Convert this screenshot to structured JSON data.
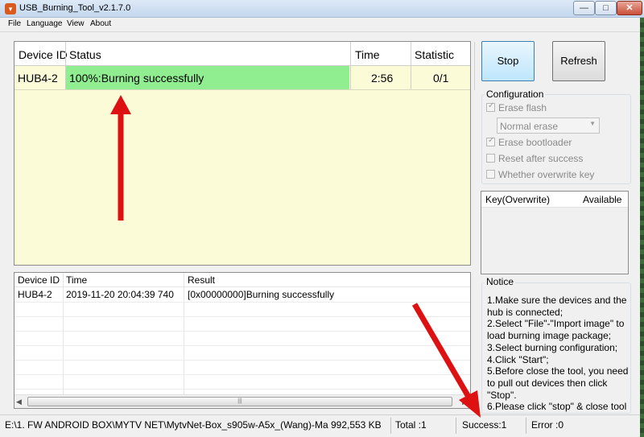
{
  "window": {
    "title": "USB_Burning_Tool_v2.1.7.0",
    "minimize": "—",
    "maximize": "□",
    "close": "✕"
  },
  "menu": {
    "items": [
      "File",
      "Language",
      "View",
      "About"
    ]
  },
  "device_table": {
    "headers": [
      "Device ID",
      "Status",
      "Time",
      "Statistic"
    ],
    "rows": [
      {
        "device_id": "HUB4-2",
        "status": "100%:Burning successfully",
        "time": "2:56",
        "statistic": "0/1"
      }
    ],
    "status_color": "#90ee90",
    "background": "#fbfbd8"
  },
  "buttons": {
    "stop": "Stop",
    "refresh": "Refresh"
  },
  "configuration": {
    "title": "Configuration",
    "erase_flash": {
      "label": "Erase flash",
      "checked": true,
      "enabled": false
    },
    "erase_mode": "Normal erase",
    "erase_bootloader": {
      "label": "Erase bootloader",
      "checked": true,
      "enabled": false
    },
    "reset_after_success": {
      "label": "Reset after success",
      "checked": false,
      "enabled": false
    },
    "overwrite_key": {
      "label": "Whether overwrite key",
      "checked": false,
      "enabled": false
    }
  },
  "key_table": {
    "headers": [
      "Key(Overwrite)",
      "Available"
    ]
  },
  "log_table": {
    "headers": [
      "Device ID",
      "Time",
      "Result"
    ],
    "rows": [
      {
        "device_id": "HUB4-2",
        "time": "2019-11-20 20:04:39 740",
        "result": "[0x00000000]Burning successfully"
      }
    ]
  },
  "notice": {
    "title": "Notice",
    "lines": [
      "1.Make sure the devices and the hub is connected;",
      "2.Select \"File\"-\"Import image\" to load burning image package;",
      "3.Select burning configuration;",
      "4.Click \"Start\";",
      "5.Before close the tool, you need to pull out devices then click \"Stop\".",
      "6.Please click \"stop\" & close tool"
    ]
  },
  "statusbar": {
    "image_path": "E:\\1. FW ANDROID BOX\\MYTV NET\\MytvNet-Box_s905w-A5x_(Wang)-Ma 992,553 KB",
    "total": "Total :1",
    "success": "Success:1",
    "error": "Error :0"
  },
  "annotation": {
    "arrow_color": "#dd1111"
  }
}
